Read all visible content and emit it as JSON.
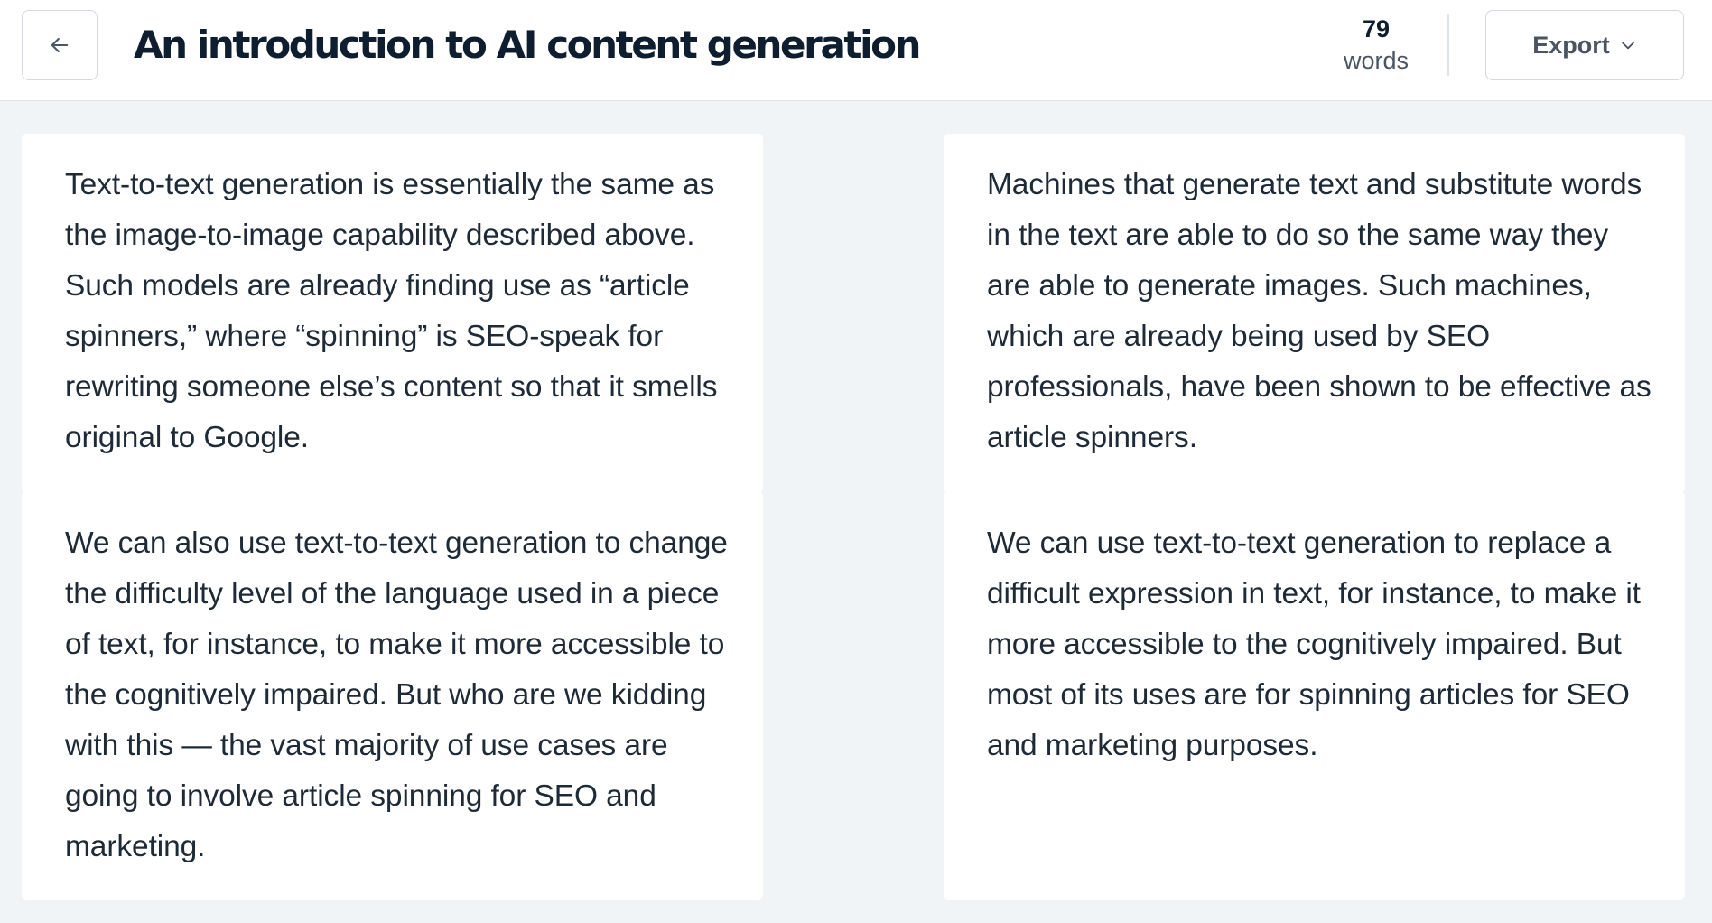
{
  "header": {
    "title": "An introduction to AI content generation",
    "word_count": "79",
    "word_count_label": "words",
    "export_label": "Export"
  },
  "icons": {
    "back": "arrow-left-icon",
    "export_chevron": "chevron-down-icon"
  },
  "rows": [
    {
      "original": "Text-to-text generation is essentially the same as the image-to-image capability described above. Such models are already finding use as “article spinners,” where “spinning” is SEO-speak for rewriting someone else’s content so that it smells original to Google.",
      "rewritten": "Machines that generate text and substitute words in the text are able to do so the same way they are able to generate images. Such machines, which are already being used by SEO professionals, have been shown to be effective as article spinners."
    },
    {
      "original": "We can also use text-to-text generation to change the difficulty level of the language used in a piece of text, for instance, to make it more accessible to the cognitively impaired. But who are we kidding with this — the vast majority of use cases are going to involve article spinning for SEO and marketing.",
      "rewritten": "We can use text-to-text generation to replace a difficult expression in text, for instance, to make it more accessible to the cognitively impaired. But most of its uses are for spinning articles for SEO and marketing purposes."
    }
  ]
}
